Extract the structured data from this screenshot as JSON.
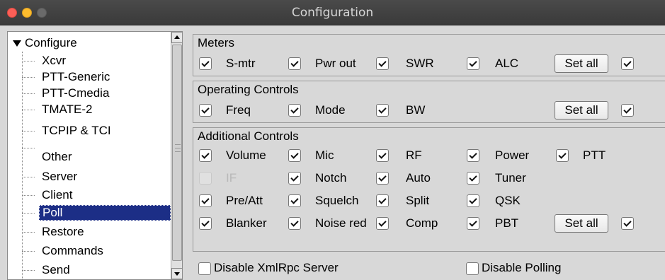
{
  "window": {
    "title": "Configuration"
  },
  "tree": {
    "root": "Configure",
    "items": [
      "Xcvr",
      "PTT-Generic",
      "PTT-Cmedia",
      "TMATE-2",
      "TCPIP & TCI",
      "Other",
      "Server",
      "Client",
      "Poll",
      "Restore",
      "Commands",
      "Send"
    ],
    "selected": "Poll"
  },
  "meters": {
    "title": "Meters",
    "items": [
      {
        "label": "S-mtr",
        "checked": true
      },
      {
        "label": "Pwr out",
        "checked": true
      },
      {
        "label": "SWR",
        "checked": true
      },
      {
        "label": "ALC",
        "checked": true
      }
    ],
    "set_all_label": "Set all",
    "set_all_checked": true
  },
  "operating": {
    "title": "Operating Controls",
    "items": [
      {
        "label": "Freq",
        "checked": true
      },
      {
        "label": "Mode",
        "checked": true
      },
      {
        "label": "BW",
        "checked": true
      }
    ],
    "set_all_label": "Set all",
    "set_all_checked": true
  },
  "additional": {
    "title": "Additional Controls",
    "rows": [
      [
        {
          "label": "Volume",
          "checked": true
        },
        {
          "label": "Mic",
          "checked": true
        },
        {
          "label": "RF",
          "checked": true
        },
        {
          "label": "Power",
          "checked": true
        },
        {
          "label": "PTT",
          "checked": true
        }
      ],
      [
        {
          "label": "IF",
          "checked": false,
          "disabled": true
        },
        {
          "label": "Notch",
          "checked": true
        },
        {
          "label": "Auto",
          "checked": true
        },
        {
          "label": "Tuner",
          "checked": true
        }
      ],
      [
        {
          "label": "Pre/Att",
          "checked": true
        },
        {
          "label": "Squelch",
          "checked": true
        },
        {
          "label": "Split",
          "checked": true
        },
        {
          "label": "QSK",
          "checked": true
        }
      ],
      [
        {
          "label": "Blanker",
          "checked": true
        },
        {
          "label": "Noise red",
          "checked": true
        },
        {
          "label": "Comp",
          "checked": true
        },
        {
          "label": "PBT",
          "checked": true
        }
      ]
    ],
    "set_all_label": "Set all",
    "set_all_checked": true
  },
  "bottom": {
    "disable_xmlrpc_label": "Disable XmlRpc Server",
    "disable_xmlrpc_checked": false,
    "disable_polling_label": "Disable Polling",
    "disable_polling_checked": false
  }
}
